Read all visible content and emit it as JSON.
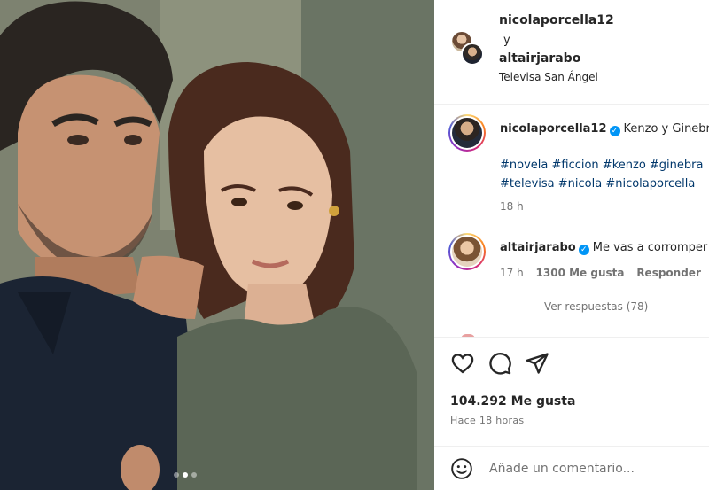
{
  "post": {
    "image_alt": "Selfie de dos personas",
    "carousel_dots": 3,
    "active_dot": 1
  },
  "header": {
    "collab_user_1": "nicolaporcella12",
    "conjunction": "y",
    "collab_user_2": "altairjarabo",
    "location": "Televisa San Ángel"
  },
  "caption": {
    "username": "nicolaporcella12",
    "text": "Kenzo y Ginebra",
    "hashtags_line1": "#novela #ficcion #kenzo #ginebra",
    "hashtags_line2": "#televisa #nicola #nicolaporcella",
    "time": "18 h"
  },
  "comment": {
    "username": "altairjarabo",
    "text": "Me vas a corromper",
    "time": "17 h",
    "likes": "1300 Me gusta",
    "reply": "Responder",
    "view_replies": "Ver respuestas (78)"
  },
  "stats": {
    "likes": "104.292 Me gusta",
    "time": "Hace 18 horas"
  },
  "add_comment": {
    "placeholder": "Añade un comentario..."
  },
  "icons": {
    "like": "heart-icon",
    "comment": "comment-icon",
    "share": "send-icon",
    "emoji": "emoji-icon",
    "verified": "verified-badge-icon"
  },
  "colors": {
    "hashtag": "#00376b",
    "verified": "#0095f6",
    "muted": "#737373"
  }
}
